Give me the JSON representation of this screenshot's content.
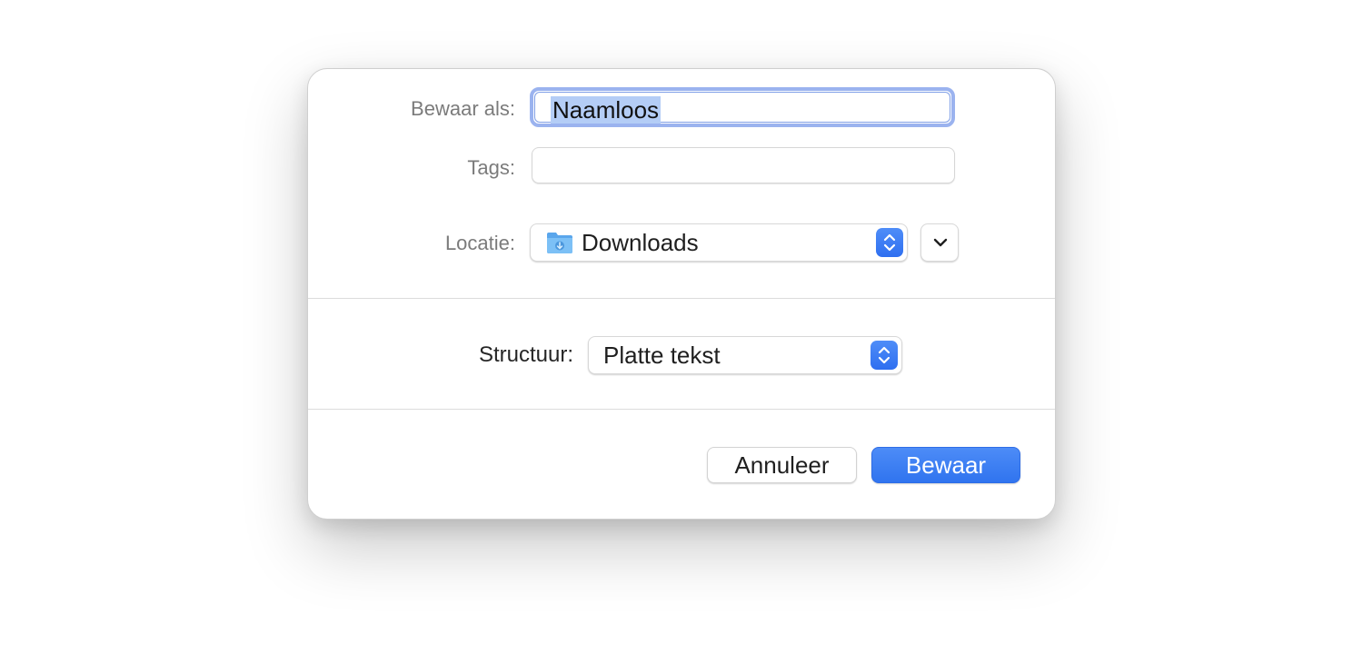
{
  "dialog": {
    "save_as_label": "Bewaar als:",
    "filename_value": "Naamloos",
    "tags_label": "Tags:",
    "tags_value": "",
    "location_label": "Locatie:",
    "location_value": "Downloads",
    "format_label": "Structuur:",
    "format_value": "Platte tekst",
    "cancel_label": "Annuleer",
    "save_label": "Bewaar"
  },
  "icons": {
    "location_icon": "downloads-folder-icon",
    "popup_icon": "up-down-chevron-icon",
    "expand_icon": "chevron-down-icon"
  },
  "colors": {
    "accent": "#3478f6",
    "focus_ring": "#9bb3ef",
    "selection": "#b4cdf6",
    "folder": "#6fb6f2"
  }
}
